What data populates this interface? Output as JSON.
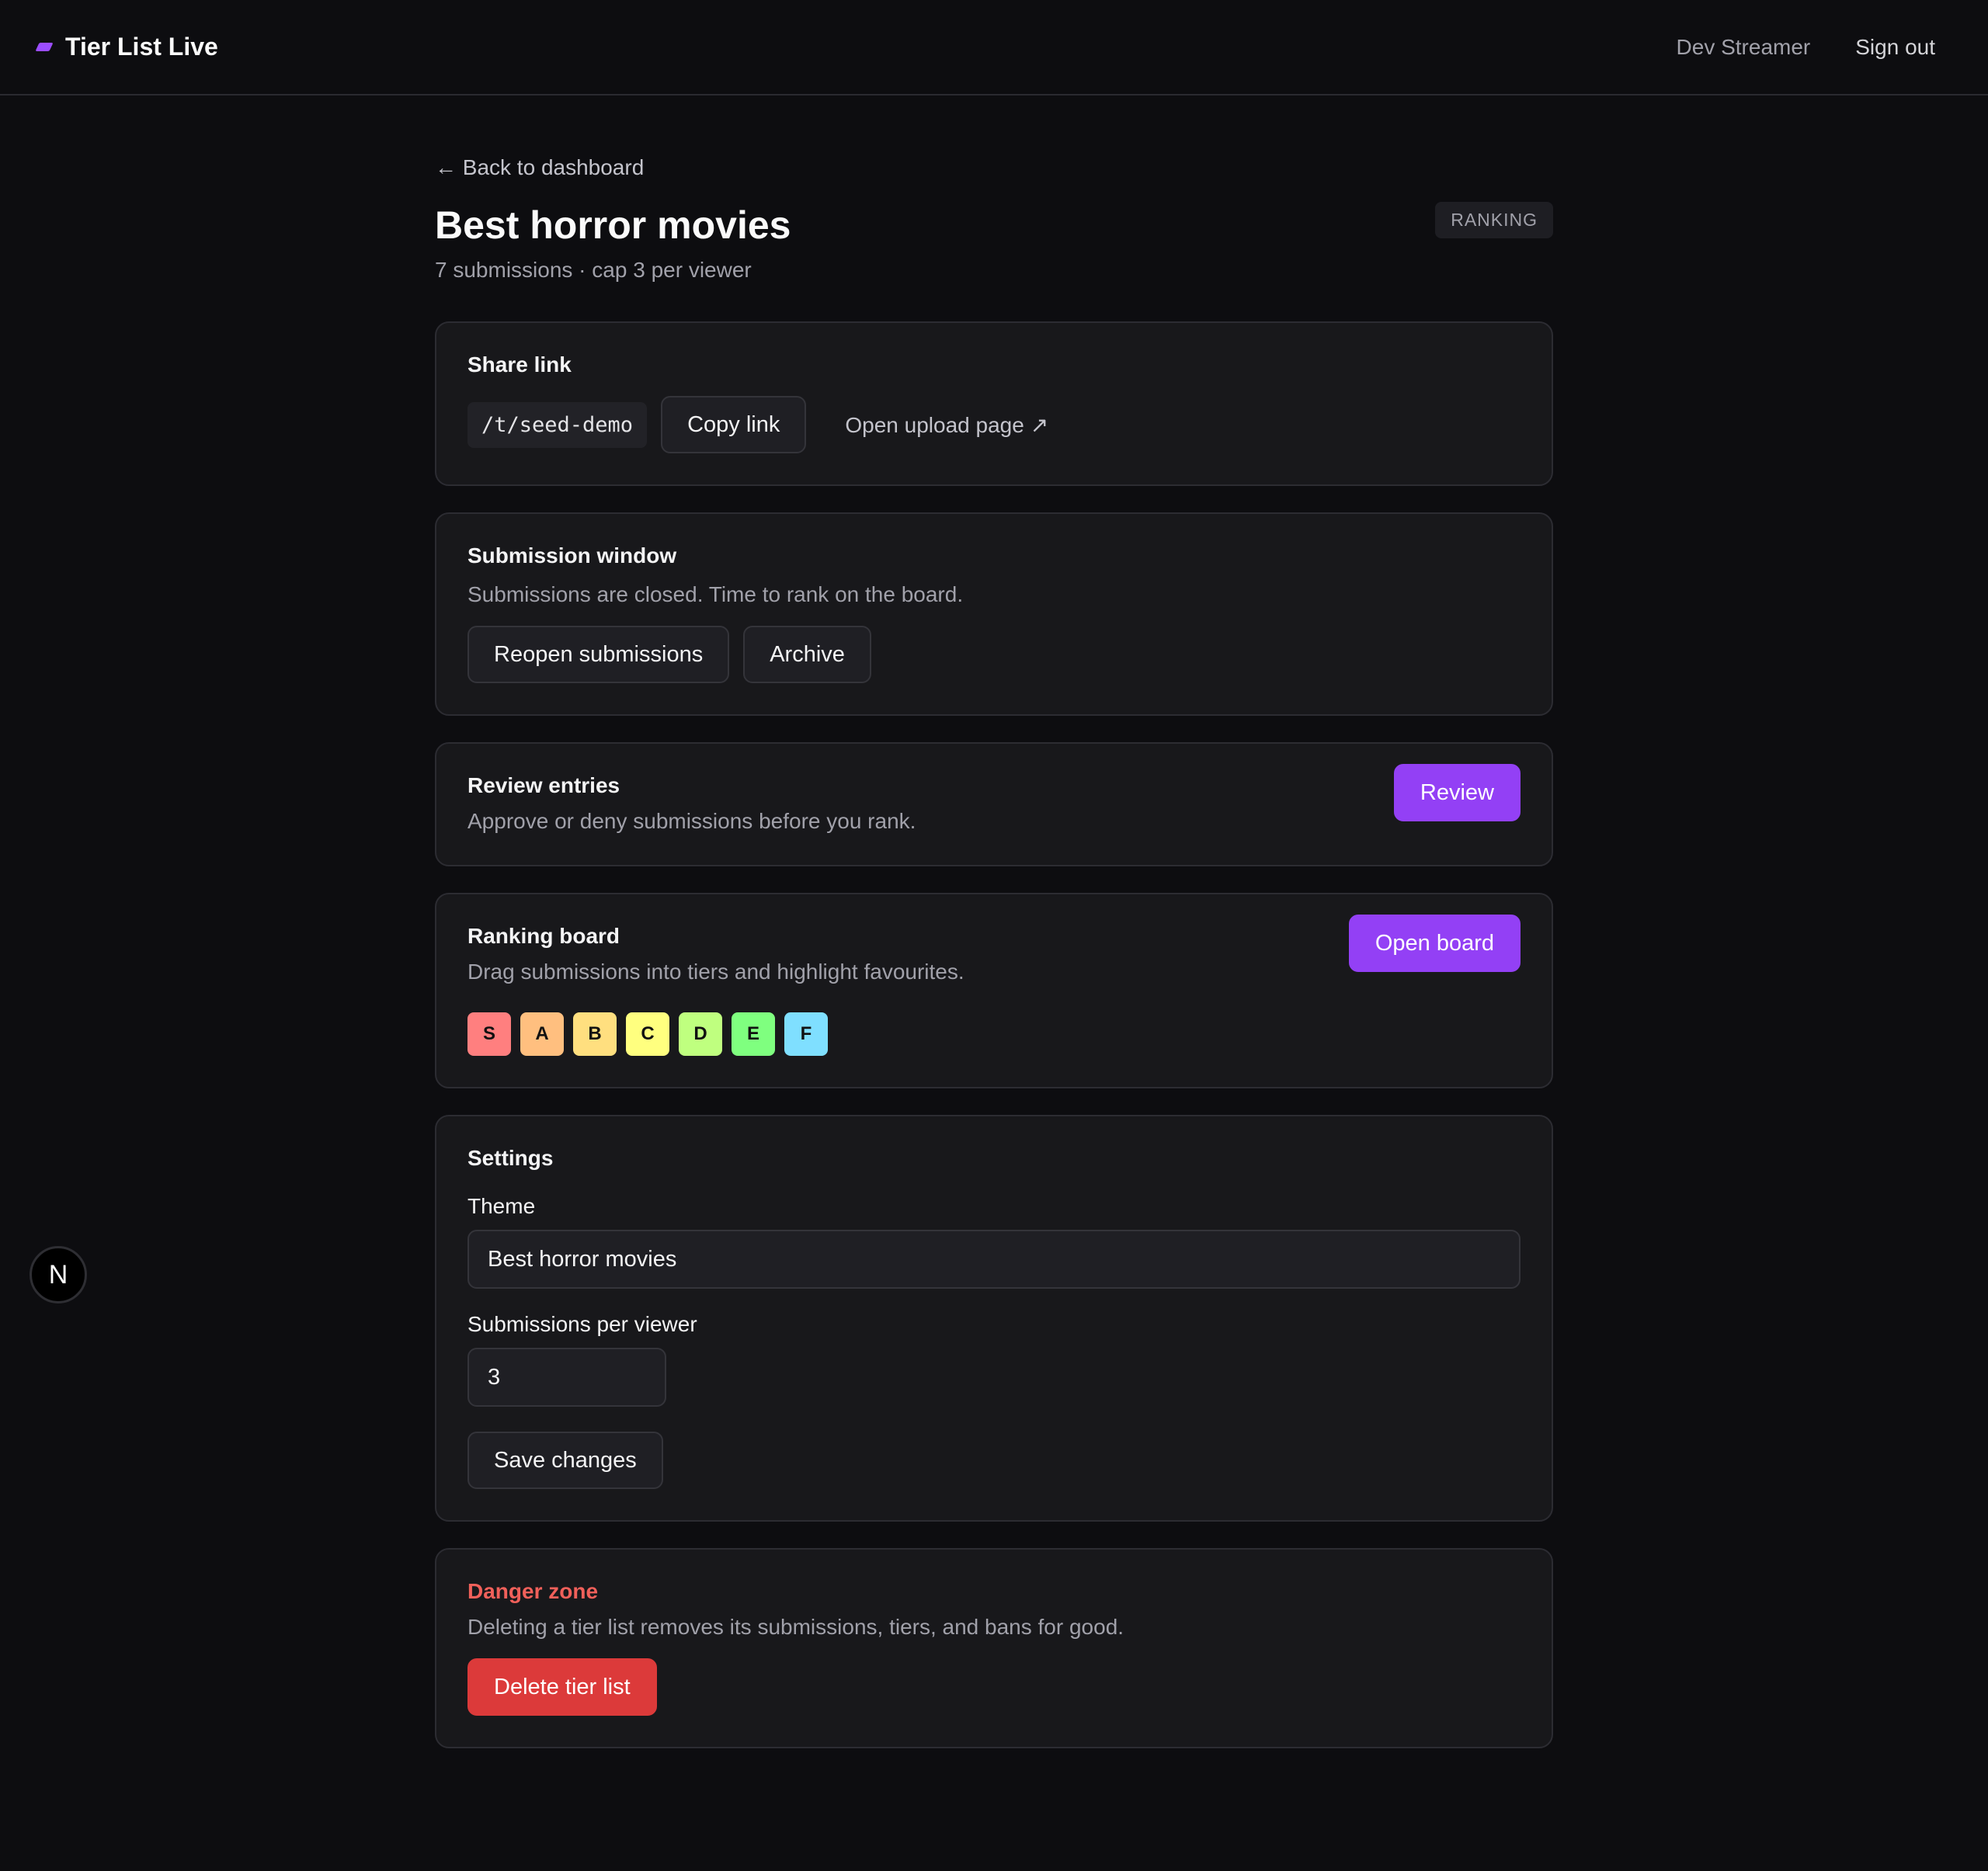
{
  "header": {
    "brand": "Tier List Live",
    "user_name": "Dev Streamer",
    "sign_out": "Sign out",
    "accent_color": "#9b4dff"
  },
  "page": {
    "back_link": "← Back to dashboard",
    "title": "Best horror movies",
    "status": "RANKING",
    "subtitle": "7 submissions · cap 3 per viewer"
  },
  "share": {
    "title": "Share link",
    "path": "/t/seed-demo",
    "copy_label": "Copy link",
    "open_label": "Open upload page ↗"
  },
  "submission_window": {
    "title": "Submission window",
    "description": "Submissions are closed. Time to rank on the board.",
    "reopen_label": "Reopen submissions",
    "archive_label": "Archive"
  },
  "review": {
    "title": "Review entries",
    "description": "Approve or deny submissions before you rank.",
    "button_label": "Review"
  },
  "board": {
    "title": "Ranking board",
    "description": "Drag submissions into tiers and highlight favourites.",
    "button_label": "Open board",
    "tiers": [
      {
        "label": "S",
        "color": "#ff7f7f"
      },
      {
        "label": "A",
        "color": "#ffbf7f"
      },
      {
        "label": "B",
        "color": "#ffdf7f"
      },
      {
        "label": "C",
        "color": "#ffff7f"
      },
      {
        "label": "D",
        "color": "#bfff7f"
      },
      {
        "label": "E",
        "color": "#7fff7f"
      },
      {
        "label": "F",
        "color": "#7fdfff"
      }
    ]
  },
  "settings": {
    "title": "Settings",
    "theme_label": "Theme",
    "theme_value": "Best horror movies",
    "per_viewer_label": "Submissions per viewer",
    "per_viewer_value": "3",
    "save_label": "Save changes"
  },
  "danger": {
    "title": "Danger zone",
    "description": "Deleting a tier list removes its submissions, tiers, and bans for good.",
    "delete_label": "Delete tier list",
    "color": "#dc3a3a"
  },
  "fab": {
    "label": "N"
  }
}
